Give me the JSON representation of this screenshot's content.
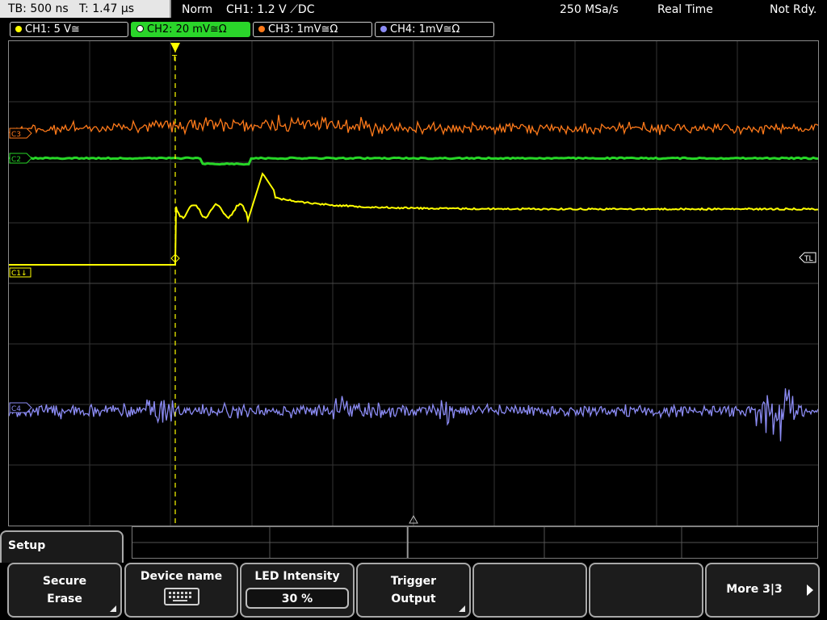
{
  "topbar": {
    "timebase": "TB: 500 ns",
    "trigger_time": "T: 1.47 µs",
    "trigger_mode": "Norm",
    "trigger_source": "CH1: 1.2 V ⟋DC",
    "sample_rate": "250 MSa/s",
    "acq_mode": "Real Time",
    "status": "Not Rdy."
  },
  "channels": [
    {
      "label": "CH1: 5 V≅",
      "color": "#ffff00"
    },
    {
      "label": "CH2: 20 mV≅Ω",
      "color": "#27d627",
      "active": true
    },
    {
      "label": "CH3: 1mV≅Ω",
      "color": "#ff7a1a"
    },
    {
      "label": "CH4: 1mV≅Ω",
      "color": "#8c8cf5"
    }
  ],
  "markers": {
    "ch1": "C1↓",
    "ch2": "C2",
    "ch3": "C3",
    "ch4": "C4",
    "trigger_level": "TL",
    "trigger_pos": "T"
  },
  "menu": {
    "title": "Setup",
    "softkeys": [
      {
        "line1": "Secure",
        "line2": "Erase"
      },
      {
        "line1": "Device name",
        "icon": "keyboard-icon"
      },
      {
        "line1": "LED Intensity",
        "value": "30 %"
      },
      {
        "line1": "Trigger",
        "line2": "Output"
      },
      {
        "line1": ""
      },
      {
        "line1": ""
      },
      {
        "line1": "More 3|3"
      }
    ]
  }
}
